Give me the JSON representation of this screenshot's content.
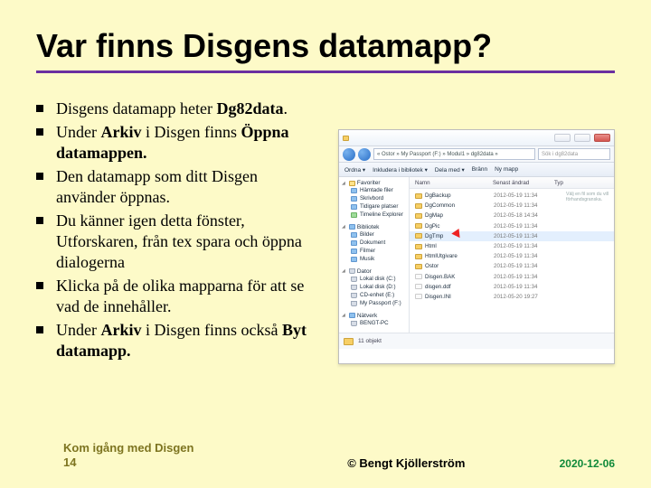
{
  "title": "Var finns Disgens datamapp?",
  "bullets": {
    "i0a": "Disgens datamapp heter ",
    "i0b": "Dg82data",
    "i0c": ".",
    "i1a": "Under ",
    "i1b": "Arkiv ",
    "i1c": "i Disgen finns ",
    "i1d": "Öppna datamappen.",
    "i2": "Den datamapp som ditt Disgen använder öppnas.",
    "i3": "Du känner igen detta fönster, Utforskaren, från tex spara och öppna dialogerna",
    "i4": "Klicka på de olika mapparna för att se vad de innehåller.",
    "i5a": "Under ",
    "i5b": "Arkiv ",
    "i5c": "i Disgen finns också ",
    "i5d": "Byt datamapp."
  },
  "explorer": {
    "breadcrumb": "« Ostor » My Passport (F:) » Modul1 » dg82data »",
    "searchPlaceholder": "Sök i dg82data",
    "toolbar": {
      "t0": "Ordna ▾",
      "t1": "Inkludera i bibliotek ▾",
      "t2": "Dela med ▾",
      "t3": "Bränn",
      "t4": "Ny mapp"
    },
    "side": {
      "fav": "Favoriter",
      "fav_items": [
        "Hämtade filer",
        "Skrivbord",
        "Tidigare platser",
        "Timeline Explorer"
      ],
      "lib": "Bibliotek",
      "lib_items": [
        "Bilder",
        "Dokument",
        "Filmer",
        "Musik"
      ],
      "comp": "Dator",
      "comp_items": [
        "Lokal disk (C:)",
        "Lokal disk (D:)",
        "CD-enhet (E:)",
        "My Passport (F:)"
      ],
      "net": "Nätverk",
      "net_items": [
        "BENGT-PC"
      ]
    },
    "cols": {
      "name": "Namn",
      "date": "Senast ändrad",
      "type": "Typ"
    },
    "rows": [
      {
        "n": "DgBackup",
        "d": "2012-05-19 11:34"
      },
      {
        "n": "DgCommon",
        "d": "2012-05-19 11:34"
      },
      {
        "n": "DgMap",
        "d": "2012-05-18 14:34"
      },
      {
        "n": "DgPic",
        "d": "2012-05-19 11:34"
      },
      {
        "n": "DgTmp",
        "d": "2012-05-19 11:34"
      },
      {
        "n": "Html",
        "d": "2012-05-19 11:34"
      },
      {
        "n": "HtmlUtgivare",
        "d": "2012-05-19 11:34"
      },
      {
        "n": "Ostor",
        "d": "2012-05-19 11:34"
      },
      {
        "n": "Disgen.BAK",
        "d": "2012-05-19 11:34"
      },
      {
        "n": "disgen.ddf",
        "d": "2012-05-19 11:34"
      },
      {
        "n": "Disgen.INI",
        "d": "2012-05-20 19:27"
      }
    ],
    "status": "11 objekt",
    "rightnote": "Välj en fil som du vill förhandsgranska."
  },
  "footer": {
    "left1": "Kom igång med Disgen",
    "left2": "14",
    "center": "© Bengt Kjöllerström",
    "right": "2020-12-06"
  }
}
